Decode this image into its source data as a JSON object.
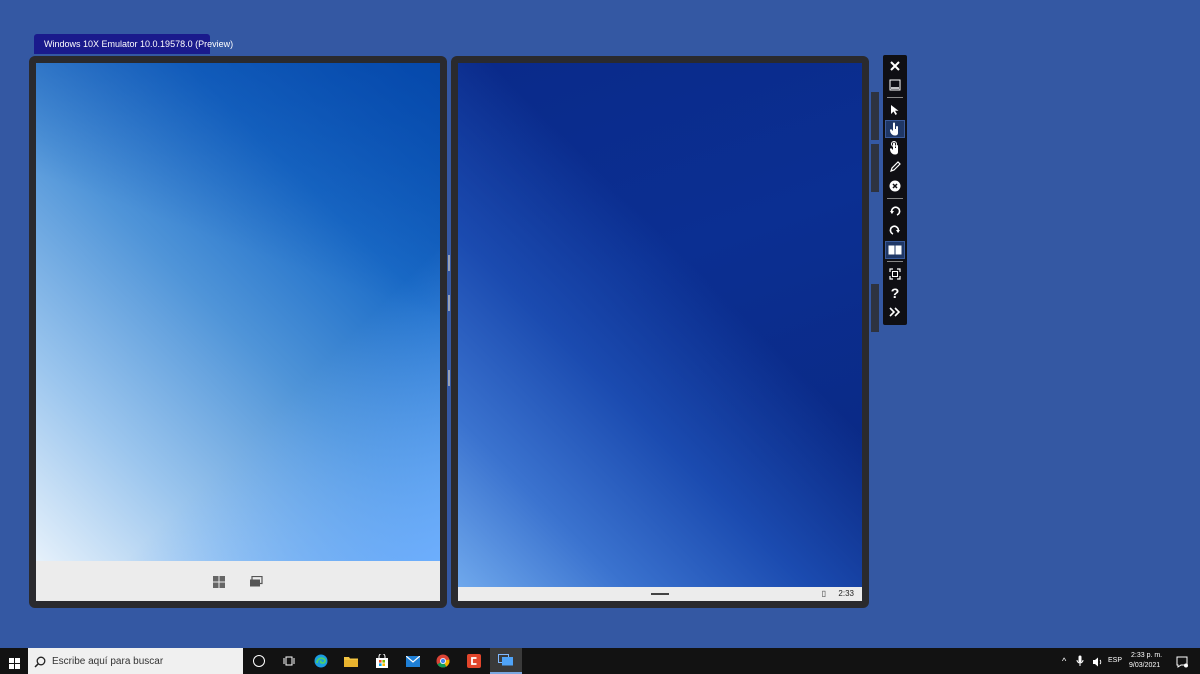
{
  "emulator": {
    "title": "Windows 10X Emulator 10.0.19578.0 (Preview)"
  },
  "right_screen": {
    "clock": "2:33"
  },
  "toolbar": {
    "buttons": [
      {
        "icon": "close-icon"
      },
      {
        "icon": "minimize-icon"
      },
      {
        "icon": "mouse-pointer-icon"
      },
      {
        "icon": "single-touch-icon"
      },
      {
        "icon": "multi-touch-icon"
      },
      {
        "icon": "pen-icon"
      },
      {
        "icon": "eraser-icon"
      },
      {
        "icon": "rotate-left-icon"
      },
      {
        "icon": "rotate-right-icon"
      },
      {
        "icon": "dual-screen-icon"
      },
      {
        "icon": "fit-to-screen-icon"
      },
      {
        "icon": "help-icon"
      },
      {
        "icon": "more-icon"
      }
    ]
  },
  "taskbar": {
    "search_placeholder": "Escribe aquí para buscar",
    "language": "ESP",
    "time": "2:33 p. m.",
    "date": "9/03/2021"
  }
}
